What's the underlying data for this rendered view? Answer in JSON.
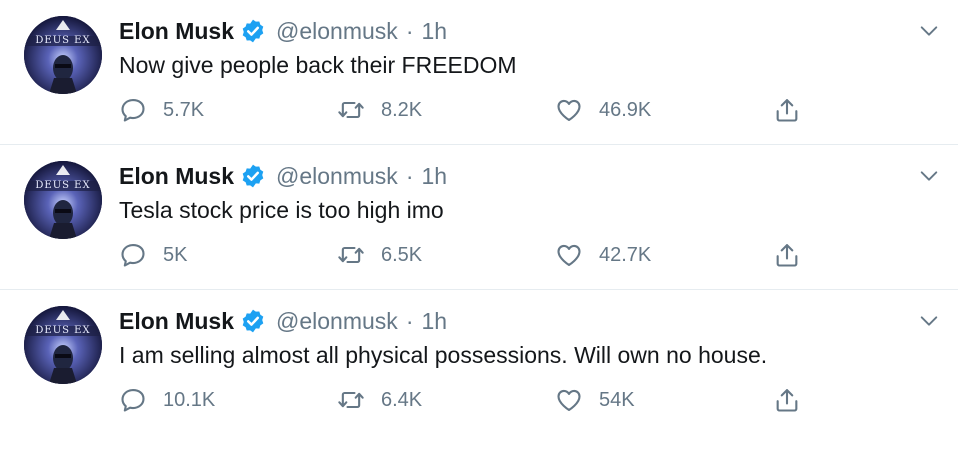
{
  "colors": {
    "verified": "#1da1f2",
    "secondary_text": "#657786",
    "primary_text": "#14171a",
    "divider": "#e6ecf0"
  },
  "avatar_text": "DEUS EX",
  "tweets": [
    {
      "name": "Elon Musk",
      "handle": "@elonmusk",
      "separator": "·",
      "time": "1h",
      "text": "Now give people back their FREEDOM",
      "replies": "5.7K",
      "retweets": "8.2K",
      "likes": "46.9K"
    },
    {
      "name": "Elon Musk",
      "handle": "@elonmusk",
      "separator": "·",
      "time": "1h",
      "text": "Tesla stock price is too high imo",
      "replies": "5K",
      "retweets": "6.5K",
      "likes": "42.7K"
    },
    {
      "name": "Elon Musk",
      "handle": "@elonmusk",
      "separator": "·",
      "time": "1h",
      "text": "I am selling almost all physical possessions. Will own no house.",
      "replies": "10.1K",
      "retweets": "6.4K",
      "likes": "54K"
    }
  ],
  "icons": {
    "reply": "reply-icon",
    "retweet": "retweet-icon",
    "like": "like-icon",
    "share": "share-icon",
    "more": "chevron-down-icon",
    "verified": "verified-badge-icon"
  }
}
